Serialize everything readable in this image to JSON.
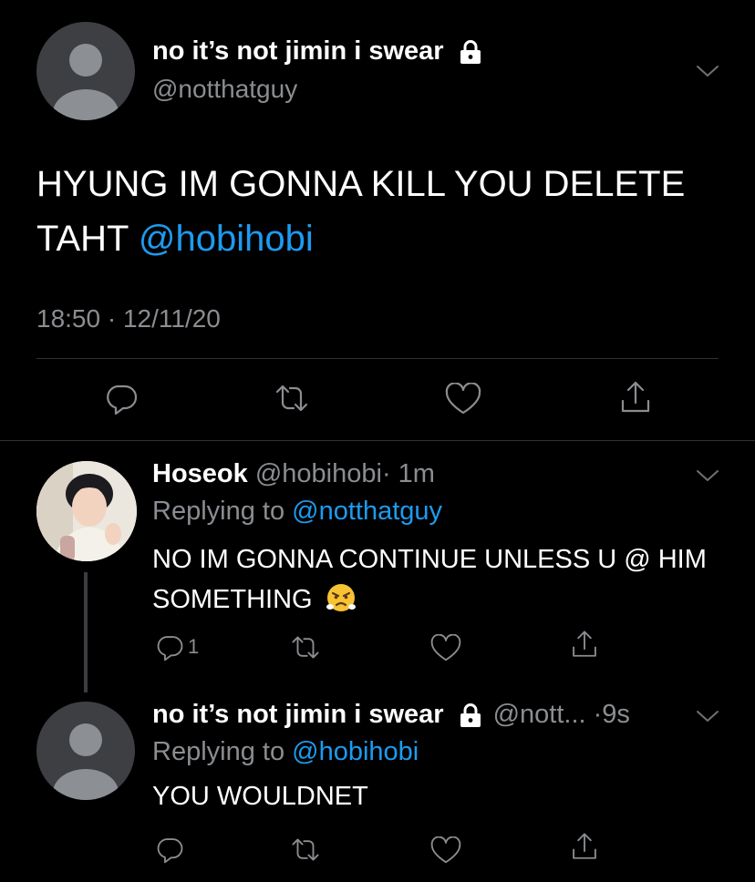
{
  "main_tweet": {
    "display_name": "no it’s not jimin i swear",
    "handle": "@notthatguy",
    "text": "HYUNG IM GONNA KILL YOU DELETE TAHT ",
    "mention": "@hobihobi",
    "timestamp": "18:50 · 12/11/20"
  },
  "reply_1": {
    "display_name": "Hoseok",
    "handle": "@hobihobi",
    "time": "· 1m",
    "replying_prefix": "Replying to ",
    "replying_handle": "@notthatguy",
    "text": "NO IM GONNA CONTINUE UNLESS U @ HIM SOMETHING",
    "emoji": "😤",
    "reply_count": "1"
  },
  "reply_2": {
    "display_name": "no it’s not jimin i swear",
    "handle": "@nott...",
    "time": "·9s",
    "replying_prefix": "Replying to ",
    "replying_handle": "@hobihobi",
    "text": "YOU WOULDNET"
  },
  "colors": {
    "background": "#000000",
    "link": "#1d9bf0",
    "muted": "#8a8d91"
  },
  "icons": [
    "reply-icon",
    "retweet-icon",
    "like-icon",
    "share-icon",
    "lock-icon",
    "chevron-down-icon",
    "avatar-default-icon"
  ]
}
